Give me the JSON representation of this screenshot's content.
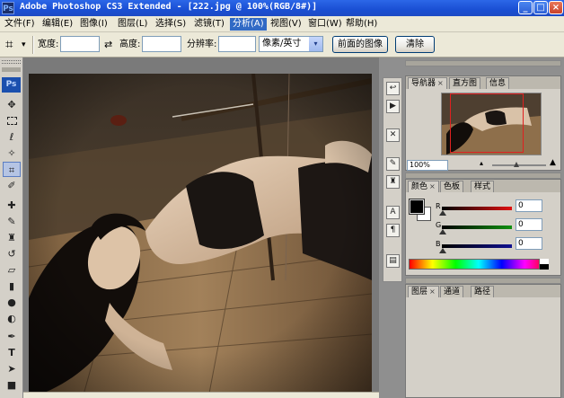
{
  "titlebar": {
    "app_icon": "Ps",
    "title": "Adobe Photoshop CS3 Extended - [222.jpg @ 100%(RGB/8#)]",
    "minimize": "_",
    "maximize": "□",
    "close": "×"
  },
  "menu": [
    {
      "label": "文件(F)"
    },
    {
      "label": "编辑(E)"
    },
    {
      "label": "图像(I)"
    },
    {
      "label": "图层(L)"
    },
    {
      "label": "选择(S)"
    },
    {
      "label": "滤镜(T)"
    },
    {
      "label": "分析(A)",
      "active": true
    },
    {
      "label": "视图(V)"
    },
    {
      "label": "窗口(W)"
    },
    {
      "label": "帮助(H)"
    }
  ],
  "options": {
    "crop_icon": "crop-icon",
    "tool_menu_arrow": "▾",
    "width_label": "宽度:",
    "width_value": "",
    "swap_icon": "⇄",
    "height_label": "高度:",
    "height_value": "",
    "resolution_label": "分辨率:",
    "resolution_value": "",
    "unit_select": "像素/英寸",
    "unit_arrow": "▾",
    "front_image_button": "前面的图像",
    "clear_button": "清除"
  },
  "tools": {
    "logo": "Ps"
  },
  "navigator": {
    "tabs": [
      "导航器",
      "直方图",
      "信息"
    ],
    "close_glyph": "×",
    "zoom": "100%",
    "zoom_out_icon": "▴",
    "zoom_in_icon": "▲",
    "zoom_level": 0.45
  },
  "color_panel": {
    "tabs": [
      "颜色",
      "色板",
      "样式"
    ],
    "channels": [
      {
        "label": "R",
        "value": "0",
        "color": "#e01010"
      },
      {
        "label": "G",
        "value": "0",
        "color": "#109010"
      },
      {
        "label": "B",
        "value": "0",
        "color": "#101090"
      }
    ],
    "foreground_color": "#000000",
    "background_color": "#ffffff"
  },
  "layers_panel": {
    "tabs": [
      "图层",
      "通道",
      "路径"
    ]
  }
}
